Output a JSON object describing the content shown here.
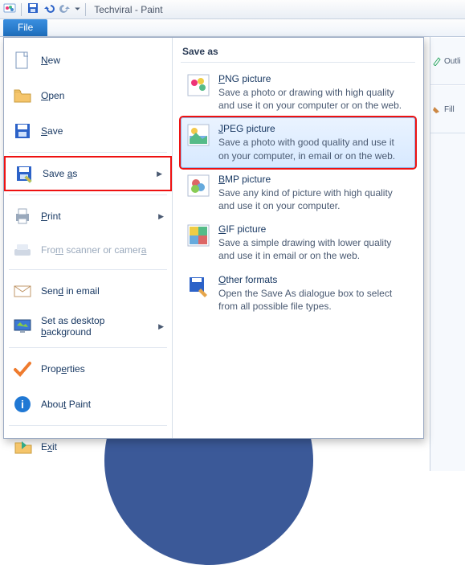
{
  "window": {
    "title": "Techviral - Paint"
  },
  "tabs": {
    "file": "File"
  },
  "right_ribbon": {
    "outline": "Outli",
    "fill": "Fill"
  },
  "menu": {
    "new": {
      "label": "New",
      "hotkey": "N"
    },
    "open": {
      "label": "Open",
      "hotkey": "O"
    },
    "save": {
      "label": "Save",
      "hotkey": "S"
    },
    "saveas": {
      "label": "Save as",
      "hotkey": "a"
    },
    "print": {
      "label": "Print",
      "hotkey": "P"
    },
    "scan": {
      "label": "From scanner or camera",
      "hotkey": "m"
    },
    "email": {
      "label": "Send in email",
      "hotkey": "d"
    },
    "desk": {
      "label": "Set as desktop background",
      "hotkey": "b"
    },
    "props": {
      "label": "Properties",
      "hotkey": "e"
    },
    "about": {
      "label": "About Paint",
      "hotkey": "t"
    },
    "exit": {
      "label": "Exit",
      "hotkey": "x"
    }
  },
  "saveas_panel": {
    "header": "Save as",
    "formats": {
      "png": {
        "title": "PNG picture",
        "hot": "P",
        "desc": "Save a photo or drawing with high quality and use it on your computer or on the web."
      },
      "jpeg": {
        "title": "JPEG picture",
        "hot": "J",
        "desc": "Save a photo with good quality and use it on your computer, in email or on the web."
      },
      "bmp": {
        "title": "BMP picture",
        "hot": "B",
        "desc": "Save any kind of picture with high quality and use it on your computer."
      },
      "gif": {
        "title": "GIF picture",
        "hot": "G",
        "desc": "Save a simple drawing with lower quality and use it in email or on the web."
      },
      "other": {
        "title": "Other formats",
        "hot": "O",
        "desc": "Open the Save As dialogue box to select from all possible file types."
      }
    }
  }
}
